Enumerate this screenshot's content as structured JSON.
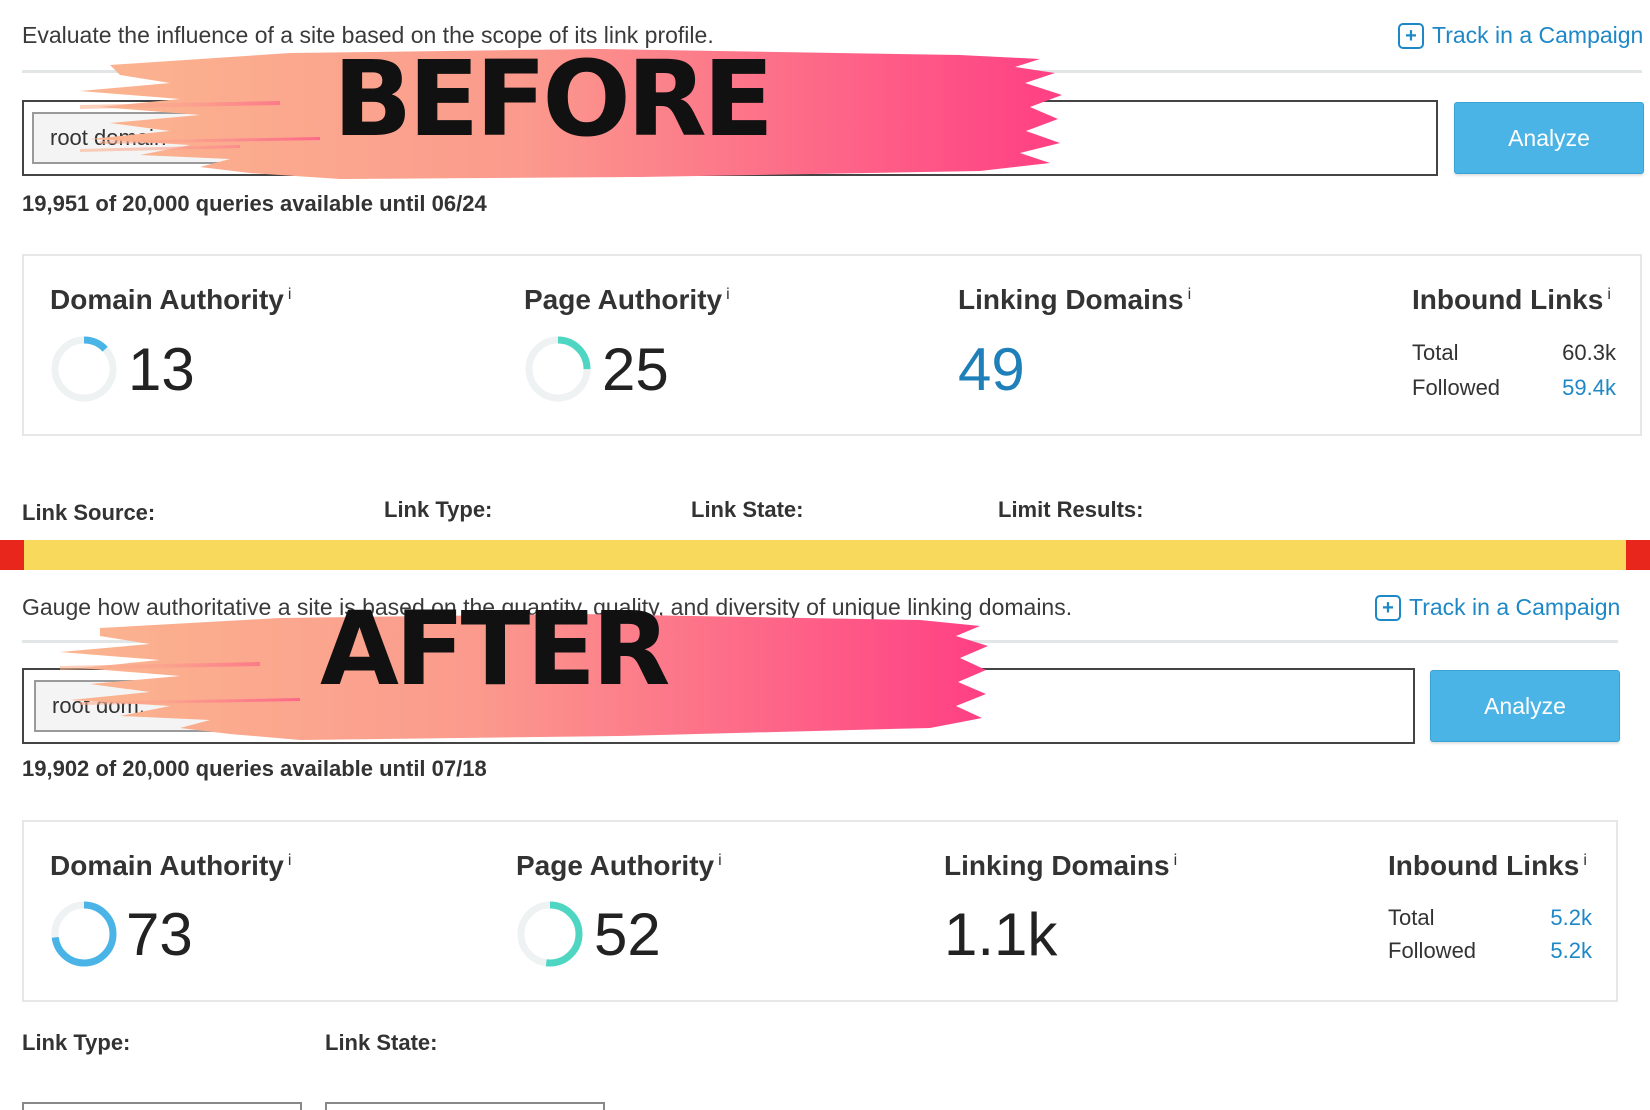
{
  "before": {
    "banner": "BEFORE",
    "description": "Evaluate the influence of a site based on the scope of its link profile.",
    "track_label": "Track in a Campaign",
    "domain_select": "root domain",
    "analyze_label": "Analyze",
    "quota": "19,951 of 20,000 queries available until 06/24",
    "metrics": {
      "domain_authority": {
        "title": "Domain Authority",
        "info": "i",
        "value": "13",
        "gauge_fraction": 0.13
      },
      "page_authority": {
        "title": "Page Authority",
        "info": "i",
        "value": "25",
        "gauge_fraction": 0.25
      },
      "linking_domains": {
        "title": "Linking Domains",
        "info": "i",
        "value": "49"
      },
      "inbound_links": {
        "title": "Inbound Links",
        "info": "i",
        "total_label": "Total",
        "total_value": "60.3k",
        "followed_label": "Followed",
        "followed_value": "59.4k"
      }
    },
    "filters": [
      "Link Source:",
      "Link Type:",
      "Link State:",
      "Limit Results:"
    ]
  },
  "after": {
    "banner": "AFTER",
    "description": "Gauge how authoritative a site is based on the quantity, quality, and diversity of unique linking domains.",
    "track_label": "Track in a Campaign",
    "domain_select": "root dom...",
    "analyze_label": "Analyze",
    "quota": "19,902 of 20,000 queries available until 07/18",
    "metrics": {
      "domain_authority": {
        "title": "Domain Authority",
        "info": "i",
        "value": "73",
        "gauge_fraction": 0.73
      },
      "page_authority": {
        "title": "Page Authority",
        "info": "i",
        "value": "52",
        "gauge_fraction": 0.52
      },
      "linking_domains": {
        "title": "Linking Domains",
        "info": "i",
        "value": "1.1k"
      },
      "inbound_links": {
        "title": "Inbound Links",
        "info": "i",
        "total_label": "Total",
        "total_value": "5.2k",
        "followed_label": "Followed",
        "followed_value": "5.2k"
      }
    },
    "filters": [
      "Link Type:",
      "Link State:"
    ]
  },
  "colors": {
    "accent_blue": "#1e88c7",
    "analyze_button": "#4bb4e6",
    "gauge_da": "#4bb4e6",
    "gauge_pa": "#4fd6c3",
    "banner_start": "#fbb58f",
    "banner_end": "#ff3f84",
    "divider_yellow": "#f9d95c",
    "divider_red": "#e8261b"
  }
}
